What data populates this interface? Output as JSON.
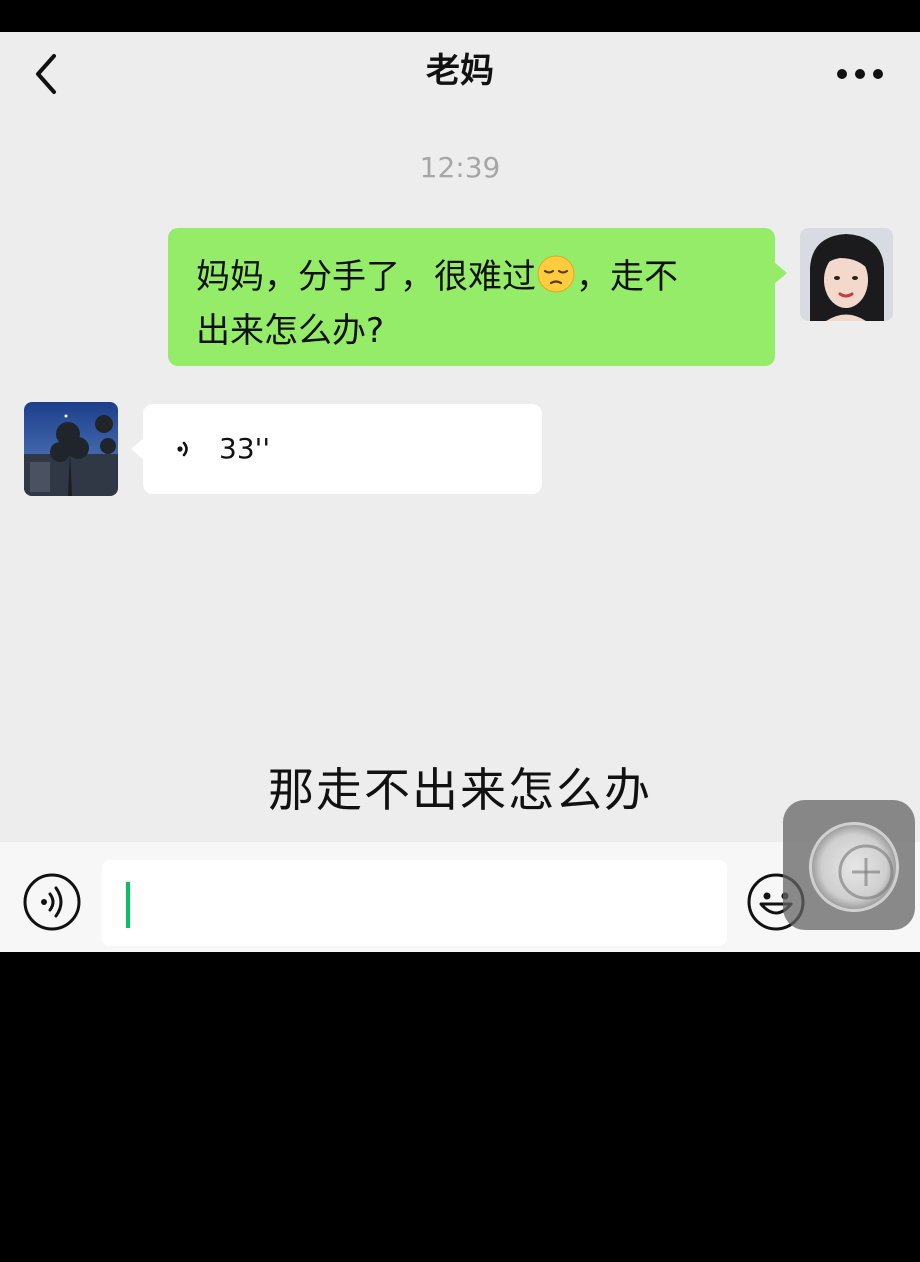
{
  "header": {
    "title": "老妈",
    "back_icon": "chevron-left-icon",
    "more_icon": "more-dots-icon"
  },
  "timestamp": "12:39",
  "messages": [
    {
      "from": "me",
      "line1": "妈妈，分手了，很难过",
      "emoji": "pensive-face-emoji",
      "line1_tail": "，走不",
      "line2": "出来怎么办?"
    },
    {
      "from": "mom",
      "type": "voice",
      "duration": "33''"
    }
  ],
  "subtitle": "那走不出来怎么办",
  "input_bar": {
    "voice_icon": "voice-input-icon",
    "emoji_icon": "smiley-icon",
    "plus_icon": "plus-icon"
  },
  "colors": {
    "outgoing_bubble": "#95ec69",
    "incoming_bubble": "#ffffff",
    "background": "#ededed",
    "caret": "#07c160"
  }
}
